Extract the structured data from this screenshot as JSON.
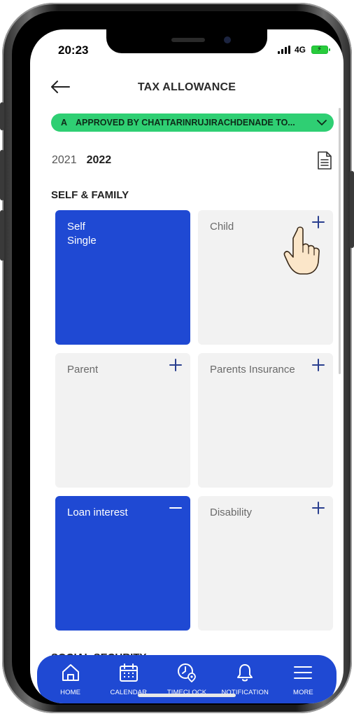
{
  "status_bar": {
    "time": "20:23",
    "network": "4G"
  },
  "header": {
    "title": "TAX ALLOWANCE"
  },
  "approval_status": {
    "prefix": "A",
    "text": "APPROVED BY CHATTARINRUJIRACHDENADE TO..."
  },
  "years": {
    "previous": "2021",
    "current": "2022"
  },
  "sections": {
    "self_family": {
      "title": "SELF & FAMILY"
    },
    "next_partial": {
      "title": "SOCIAL SECURITY"
    }
  },
  "cards": [
    {
      "label": "Self\nSingle",
      "active": true,
      "action": "none"
    },
    {
      "label": "Child",
      "active": false,
      "action": "plus"
    },
    {
      "label": "Parent",
      "active": false,
      "action": "plus"
    },
    {
      "label": "Parents Insurance",
      "active": false,
      "action": "plus"
    },
    {
      "label": "Loan interest",
      "active": true,
      "action": "minus"
    },
    {
      "label": "Disability",
      "active": false,
      "action": "plus"
    }
  ],
  "bottom_nav": {
    "items": [
      {
        "label": "HOME",
        "icon": "home-icon"
      },
      {
        "label": "CALENDAR",
        "icon": "calendar-icon"
      },
      {
        "label": "TIMECLOCK",
        "icon": "timeclock-icon"
      },
      {
        "label": "NOTIFICATION",
        "icon": "bell-icon"
      },
      {
        "label": "MORE",
        "icon": "menu-icon"
      }
    ]
  },
  "colors": {
    "accent": "#1f49d3",
    "approved": "#2fcf73",
    "card_inactive": "#f2f2f2"
  }
}
